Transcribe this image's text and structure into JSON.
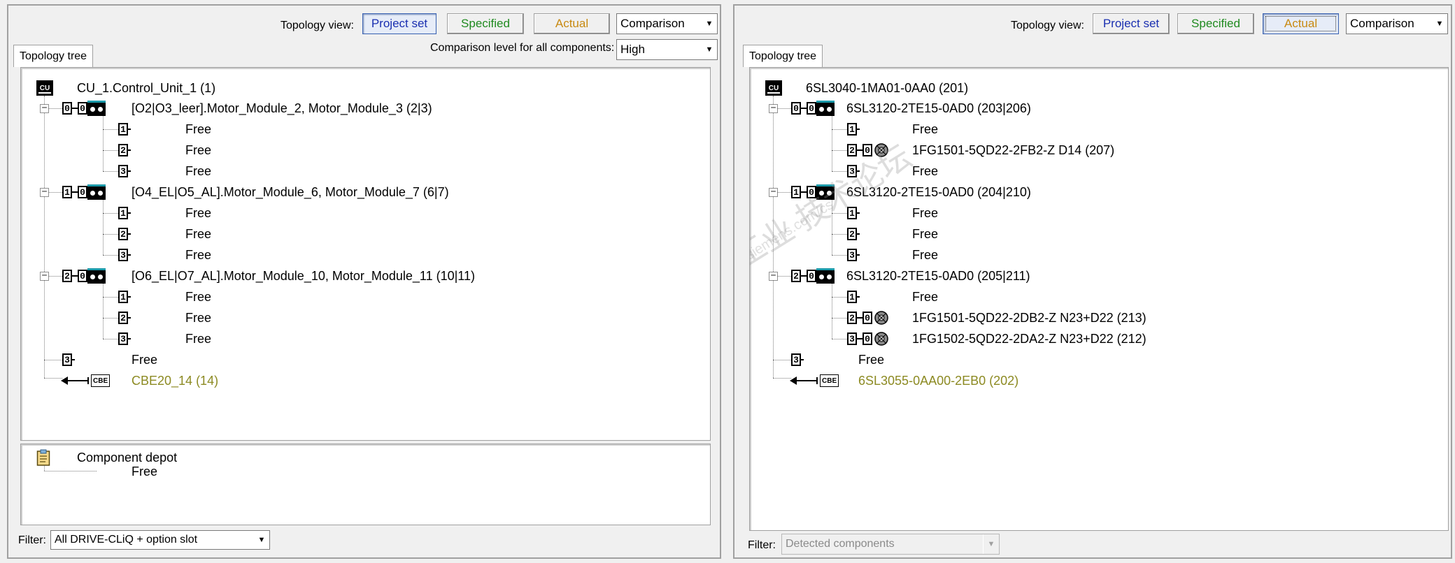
{
  "left": {
    "topology_view_label": "Topology view:",
    "view_buttons": {
      "project_set": "Project set",
      "specified": "Specified",
      "actual": "Actual"
    },
    "view_combo": "Comparison",
    "comparison_level_label": "Comparison level for all components:",
    "comparison_level_value": "High",
    "tab": "Topology tree",
    "tree": {
      "root": "CU_1.Control_Unit_1 (1)",
      "groups": [
        {
          "port": "0",
          "sub": "0",
          "label": "[O2|O3_leer].Motor_Module_2, Motor_Module_3 (2|3)",
          "children": [
            {
              "port": "1",
              "label": "Free"
            },
            {
              "port": "2",
              "label": "Free"
            },
            {
              "port": "3",
              "label": "Free"
            }
          ]
        },
        {
          "port": "1",
          "sub": "0",
          "label": "[O4_EL|O5_AL].Motor_Module_6, Motor_Module_7 (6|7)",
          "children": [
            {
              "port": "1",
              "label": "Free"
            },
            {
              "port": "2",
              "label": "Free"
            },
            {
              "port": "3",
              "label": "Free"
            }
          ]
        },
        {
          "port": "2",
          "sub": "0",
          "label": "[O6_EL|O7_AL].Motor_Module_10, Motor_Module_11 (10|11)",
          "children": [
            {
              "port": "1",
              "label": "Free"
            },
            {
              "port": "2",
              "label": "Free"
            },
            {
              "port": "3",
              "label": "Free"
            }
          ]
        }
      ],
      "free_port": {
        "port": "3",
        "label": "Free"
      },
      "cbe": {
        "icon_text": "CBE",
        "label": "CBE20_14 (14)"
      }
    },
    "depot": {
      "title": "Component depot",
      "child": "Free"
    },
    "filter_label": "Filter:",
    "filter_value": "All DRIVE-CLiQ + option slot"
  },
  "right": {
    "topology_view_label": "Topology view:",
    "view_buttons": {
      "project_set": "Project set",
      "specified": "Specified",
      "actual": "Actual"
    },
    "view_combo": "Comparison",
    "tab": "Topology tree",
    "tree": {
      "root": "6SL3040-1MA01-0AA0 (201)",
      "groups": [
        {
          "port": "0",
          "sub": "0",
          "label": "6SL3120-2TE15-0AD0 (203|206)",
          "children": [
            {
              "port": "1",
              "label": "Free"
            },
            {
              "port": "2",
              "sub": "0",
              "motor": true,
              "label": "1FG1501-5QD22-2FB2-Z D14 (207)"
            },
            {
              "port": "3",
              "label": "Free"
            }
          ]
        },
        {
          "port": "1",
          "sub": "0",
          "label": "6SL3120-2TE15-0AD0 (204|210)",
          "children": [
            {
              "port": "1",
              "label": "Free"
            },
            {
              "port": "2",
              "label": "Free"
            },
            {
              "port": "3",
              "label": "Free"
            }
          ]
        },
        {
          "port": "2",
          "sub": "0",
          "label": "6SL3120-2TE15-0AD0 (205|211)",
          "children": [
            {
              "port": "1",
              "label": "Free"
            },
            {
              "port": "2",
              "sub": "0",
              "motor": true,
              "label": "1FG1501-5QD22-2DB2-Z N23+D22 (213)"
            },
            {
              "port": "3",
              "sub": "0",
              "motor": true,
              "label": "1FG1502-5QD22-2DA2-Z N23+D22 (212)"
            }
          ]
        }
      ],
      "free_port": {
        "port": "3",
        "label": "Free"
      },
      "cbe": {
        "icon_text": "CBE",
        "label": "6SL3055-0AA00-2EB0 (202)"
      }
    },
    "filter_label": "Filter:",
    "filter_value": "Detected components"
  },
  "cu_icon_text": "CU",
  "watermark": {
    "line1": "西门子工业 技术论坛",
    "line2": "support.industry.siemens.com/cs"
  }
}
